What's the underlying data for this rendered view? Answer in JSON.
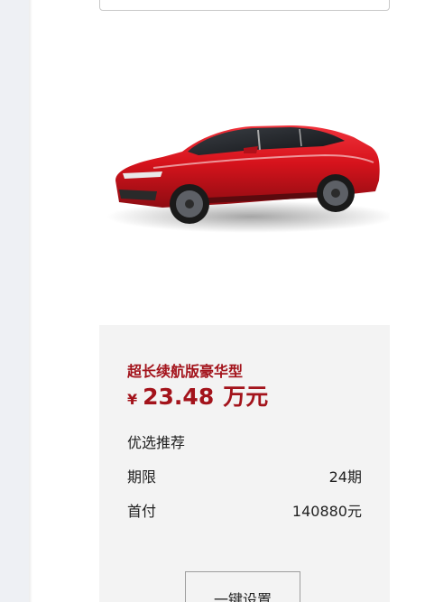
{
  "product": {
    "image_alt": "red electric sedan",
    "trim_name": "超长续航版豪华型",
    "price_currency": "¥",
    "price_value": "23.48",
    "price_unit": "万元",
    "section_label": "优选推荐",
    "term_label": "期限",
    "term_value": "24期",
    "down_payment_label": "首付",
    "down_payment_value": "140880元",
    "setup_button_label": "一键设置"
  },
  "colors": {
    "brand_red": "#a3131b",
    "car_body": "#d7131c",
    "panel_bg": "#f3f3f3",
    "gutter_bg": "#eef0f4"
  }
}
